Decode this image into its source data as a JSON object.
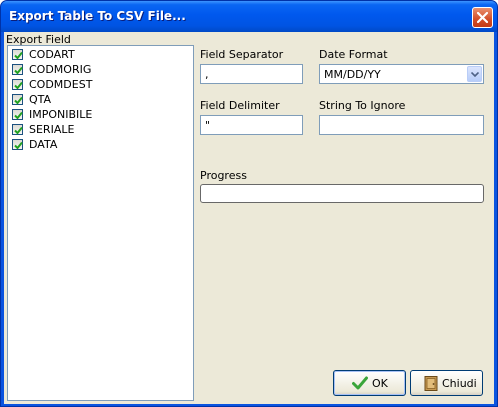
{
  "window": {
    "title": "Export Table To CSV File..."
  },
  "export_fields": {
    "label": "Export Field",
    "items": [
      {
        "name": "CODART",
        "checked": true
      },
      {
        "name": "CODMORIG",
        "checked": true
      },
      {
        "name": "CODMDEST",
        "checked": true
      },
      {
        "name": "QTA",
        "checked": true
      },
      {
        "name": "IMPONIBILE",
        "checked": true
      },
      {
        "name": "SERIALE",
        "checked": true
      },
      {
        "name": "DATA",
        "checked": true
      }
    ]
  },
  "options": {
    "field_separator_label": "Field Separator",
    "field_separator_value": ",",
    "date_format_label": "Date Format",
    "date_format_value": "MM/DD/YY",
    "field_delimiter_label": "Field Delimiter",
    "field_delimiter_value": "\"",
    "string_to_ignore_label": "String To Ignore",
    "string_to_ignore_value": ""
  },
  "progress": {
    "label": "Progress",
    "value_percent": 0
  },
  "buttons": {
    "ok_label": "OK",
    "chiudi_label": "Chiudi"
  },
  "icons": {
    "close": "close-icon",
    "check": "checkmark-icon",
    "ok": "green-check-icon",
    "chiudi": "door-icon",
    "combo": "chevron-down-icon"
  },
  "colors": {
    "titlebar": "#0054e3",
    "dialog_bg": "#ece9d8",
    "check_green": "#21a121",
    "ok_check": "#3aa53a"
  }
}
